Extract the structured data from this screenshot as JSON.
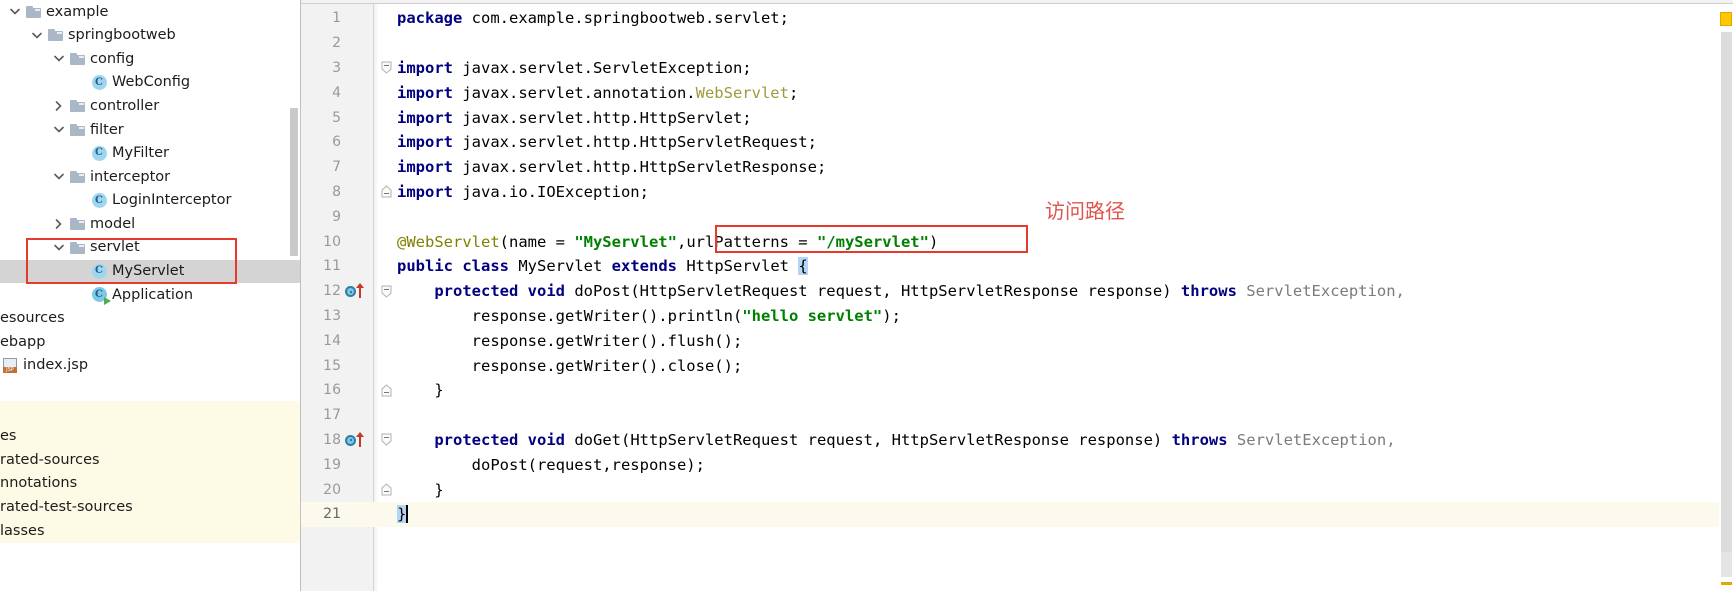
{
  "project_tree": {
    "name": "project-tool-window",
    "items": [
      {
        "label": "example",
        "indent": 0,
        "arrow": "down",
        "icon": "folder-icon",
        "state": "normal"
      },
      {
        "label": "springbootweb",
        "indent": 1,
        "arrow": "down",
        "icon": "folder-icon",
        "state": "normal"
      },
      {
        "label": "config",
        "indent": 2,
        "arrow": "down",
        "icon": "folder-icon",
        "state": "normal"
      },
      {
        "label": "WebConfig",
        "indent": 3,
        "arrow": "none",
        "icon": "java-class-icon",
        "state": "normal"
      },
      {
        "label": "controller",
        "indent": 2,
        "arrow": "right",
        "icon": "folder-icon",
        "state": "normal"
      },
      {
        "label": "filter",
        "indent": 2,
        "arrow": "down",
        "icon": "folder-icon",
        "state": "normal"
      },
      {
        "label": "MyFilter",
        "indent": 3,
        "arrow": "none",
        "icon": "java-class-icon",
        "state": "normal"
      },
      {
        "label": "interceptor",
        "indent": 2,
        "arrow": "down",
        "icon": "folder-icon",
        "state": "normal"
      },
      {
        "label": "LoginInterceptor",
        "indent": 3,
        "arrow": "none",
        "icon": "java-class-icon",
        "state": "normal"
      },
      {
        "label": "model",
        "indent": 2,
        "arrow": "right",
        "icon": "folder-icon",
        "state": "normal"
      },
      {
        "label": "servlet",
        "indent": 2,
        "arrow": "down",
        "icon": "folder-icon",
        "state": "normal"
      },
      {
        "label": "MyServlet",
        "indent": 3,
        "arrow": "none",
        "icon": "java-class-icon",
        "state": "selected"
      },
      {
        "label": "Application",
        "indent": 3,
        "arrow": "none",
        "icon": "java-runnable-class-icon",
        "state": "normal"
      },
      {
        "label": "esources",
        "indent": 0,
        "arrow": "none",
        "icon": "none",
        "state": "clipped"
      },
      {
        "label": "ebapp",
        "indent": 0,
        "arrow": "none",
        "icon": "none",
        "state": "clipped"
      },
      {
        "label": "index.jsp",
        "indent": 0,
        "arrow": "none",
        "icon": "jsp-file-icon",
        "state": "clipped"
      },
      {
        "label": "",
        "indent": 0,
        "arrow": "none",
        "icon": "none",
        "state": "clipped"
      },
      {
        "label": "",
        "indent": 0,
        "arrow": "none",
        "icon": "none",
        "state": "yellow"
      },
      {
        "label": "es",
        "indent": 0,
        "arrow": "none",
        "icon": "none",
        "state": "yellow"
      },
      {
        "label": "rated-sources",
        "indent": 0,
        "arrow": "none",
        "icon": "none",
        "state": "yellow"
      },
      {
        "label": "nnotations",
        "indent": 0,
        "arrow": "none",
        "icon": "none",
        "state": "yellow"
      },
      {
        "label": "rated-test-sources",
        "indent": 0,
        "arrow": "none",
        "icon": "none",
        "state": "yellow"
      },
      {
        "label": "lasses",
        "indent": 0,
        "arrow": "none",
        "icon": "none",
        "state": "yellow"
      }
    ]
  },
  "editor": {
    "name": "code-editor",
    "file": "MyServlet.java",
    "current_line": 21,
    "lines": [
      {
        "n": "1",
        "fold": "",
        "mark": false
      },
      {
        "n": "2",
        "fold": "",
        "mark": false
      },
      {
        "n": "3",
        "fold": "start",
        "mark": false
      },
      {
        "n": "4",
        "fold": "",
        "mark": false
      },
      {
        "n": "5",
        "fold": "",
        "mark": false
      },
      {
        "n": "6",
        "fold": "",
        "mark": false
      },
      {
        "n": "7",
        "fold": "",
        "mark": false
      },
      {
        "n": "8",
        "fold": "end",
        "mark": false
      },
      {
        "n": "9",
        "fold": "",
        "mark": false
      },
      {
        "n": "10",
        "fold": "",
        "mark": false
      },
      {
        "n": "11",
        "fold": "",
        "mark": false
      },
      {
        "n": "12",
        "fold": "start",
        "mark": true
      },
      {
        "n": "13",
        "fold": "",
        "mark": false
      },
      {
        "n": "14",
        "fold": "",
        "mark": false
      },
      {
        "n": "15",
        "fold": "",
        "mark": false
      },
      {
        "n": "16",
        "fold": "end",
        "mark": false
      },
      {
        "n": "17",
        "fold": "",
        "mark": false
      },
      {
        "n": "18",
        "fold": "start",
        "mark": true
      },
      {
        "n": "19",
        "fold": "",
        "mark": false
      },
      {
        "n": "20",
        "fold": "end",
        "mark": false
      },
      {
        "n": "21",
        "fold": "",
        "mark": false
      }
    ],
    "code": {
      "l1": "package com.example.springbootweb.servlet;",
      "l3": "import javax.servlet.ServletException;",
      "l4": "import javax.servlet.annotation.WebServlet;",
      "l5": "import javax.servlet.http.HttpServlet;",
      "l6": "import javax.servlet.http.HttpServletRequest;",
      "l7": "import javax.servlet.http.HttpServletResponse;",
      "l8": "import java.io.IOException;",
      "l10": "@WebServlet(name = \"MyServlet\",urlPatterns = \"/myServlet\")",
      "l11": "public class MyServlet extends HttpServlet {",
      "l12": "    protected void doPost(HttpServletRequest request, HttpServletResponse response) throws ServletException,",
      "l13": "        response.getWriter().println(\"hello servlet\");",
      "l14": "        response.getWriter().flush();",
      "l15": "        response.getWriter().close();",
      "l16": "    }",
      "l18": "    protected void doGet(HttpServletRequest request, HttpServletResponse response) throws ServletException,",
      "l19": "        doPost(request,response);",
      "l20": "    }",
      "l21": "}"
    },
    "tokens": {
      "kw_package": "package",
      "kw_import": "import",
      "kw_public": "public",
      "kw_class": "class",
      "kw_extends": "extends",
      "kw_protected": "protected",
      "kw_void": "void",
      "kw_throws": "throws",
      "pkg_name": " com.example.springbootweb.servlet;",
      "imp3": " javax.servlet.ServletException;",
      "imp4a": " javax.servlet.annotation.",
      "imp4b": "WebServlet",
      "imp4c": ";",
      "imp5": " javax.servlet.http.HttpServlet;",
      "imp6": " javax.servlet.http.HttpServletRequest;",
      "imp7": " javax.servlet.http.HttpServletResponse;",
      "imp8": " java.io.IOException;",
      "ann_name": "@WebServlet",
      "ann_open": "(name = ",
      "ann_servletname": "\"MyServlet\"",
      "ann_comma": ",",
      "ann_urlpatterns": "urlPatterns = ",
      "ann_path": "\"/myServlet\"",
      "ann_close": ")",
      "cls_myservlet": " MyServlet ",
      "cls_httpservlet": " HttpServlet ",
      "brace_open": "{",
      "dopost_sig": " doPost(HttpServletRequest request, HttpServletResponse response) ",
      "doget_sig": " doGet(HttpServletRequest request, HttpServletResponse response) ",
      "servlet_exception": " ServletException,",
      "body13a": "        response.getWriter().println(",
      "body13b": "\"hello servlet\"",
      "body13c": ");",
      "body14": "        response.getWriter().flush();",
      "body15": "        response.getWriter().close();",
      "body16": "    }",
      "body19": "        doPost(request,response);",
      "body20": "    }",
      "body21": "}"
    }
  },
  "callouts": {
    "url_patterns_box": "urlPatterns = \"/myServlet\")",
    "servlet_box": "servlet / MyServlet",
    "annotation_text": "访问路径",
    "annotation_color": "#e0544e",
    "box_color": "#e8392f"
  },
  "colors": {
    "keyword": "#000080",
    "string": "#008000",
    "annotation": "#808000",
    "selection": "#b5d5f5",
    "current_line": "#fcfaed",
    "tree_selected": "#d4d4d4",
    "inspection_badge": "#ffc800"
  }
}
